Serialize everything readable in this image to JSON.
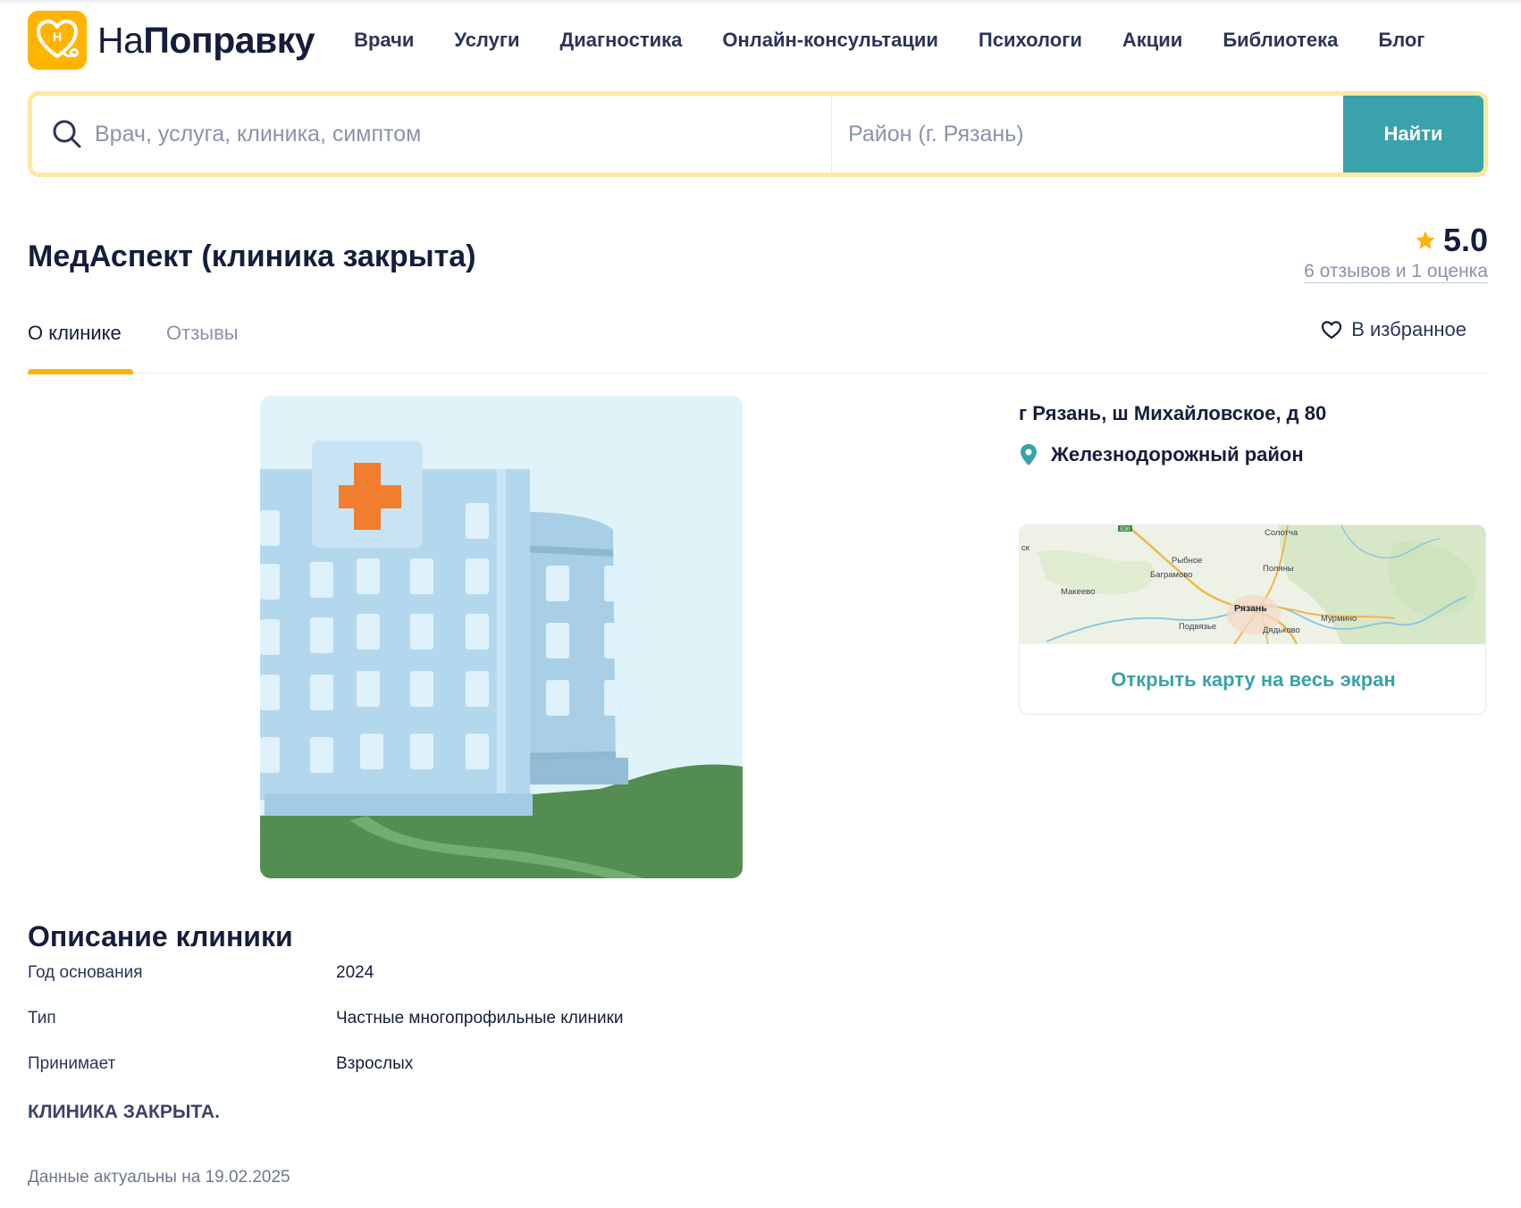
{
  "header": {
    "logo_prefix": "На",
    "logo_bold": "Поправку",
    "logo_icon": "heart-stethoscope-icon",
    "nav": [
      {
        "label": "Врачи"
      },
      {
        "label": "Услуги"
      },
      {
        "label": "Диагностика"
      },
      {
        "label": "Онлайн-консультации"
      },
      {
        "label": "Психологи"
      },
      {
        "label": "Акции"
      },
      {
        "label": "Библиотека"
      },
      {
        "label": "Блог"
      }
    ]
  },
  "search": {
    "query_placeholder": "Врач, услуга, клиника, симптом",
    "district_placeholder": "Район (г. Рязань)",
    "button_label": "Найти"
  },
  "clinic": {
    "title": "МедАспект (клиника закрыта)",
    "rating_value": "5.0",
    "rating_summary": "6 отзывов и 1 оценка",
    "address": "г Рязань, ш Михайловское, д 80",
    "district": "Железнодорожный район"
  },
  "tabs": {
    "about": "О клинике",
    "reviews": "Отзывы",
    "favorite": "В избранное"
  },
  "map": {
    "link_label": "Открыть карту на весь экран",
    "labels": {
      "ryazan": "Рязань",
      "solotcha": "Солотча",
      "rybnoe": "Рыбное",
      "bagramovo": "Баграмово",
      "polyany": "Поляны",
      "makeevo": "Макеево",
      "murmino": "Мурмино",
      "podvyazye": "Подвязье",
      "dyadkovo": "Дядьково",
      "sk": "ск",
      "road": "Е30"
    }
  },
  "description": {
    "title": "Описание клиники",
    "rows": [
      {
        "label": "Год основания",
        "value": "2024"
      },
      {
        "label": "Тип",
        "value": "Частные многопрофильные клиники"
      },
      {
        "label": "Принимает",
        "value": "Взрослых"
      }
    ],
    "closed_note": "КЛИНИКА ЗАКРЫТА.",
    "actual_date": "Данные актуальны на 19.02.2025"
  },
  "colors": {
    "accent_yellow": "#ffb400",
    "teal": "#3aa2ab",
    "text_dark": "#141e3c",
    "text_muted": "#8a93ac",
    "search_border": "#fde9a0"
  }
}
